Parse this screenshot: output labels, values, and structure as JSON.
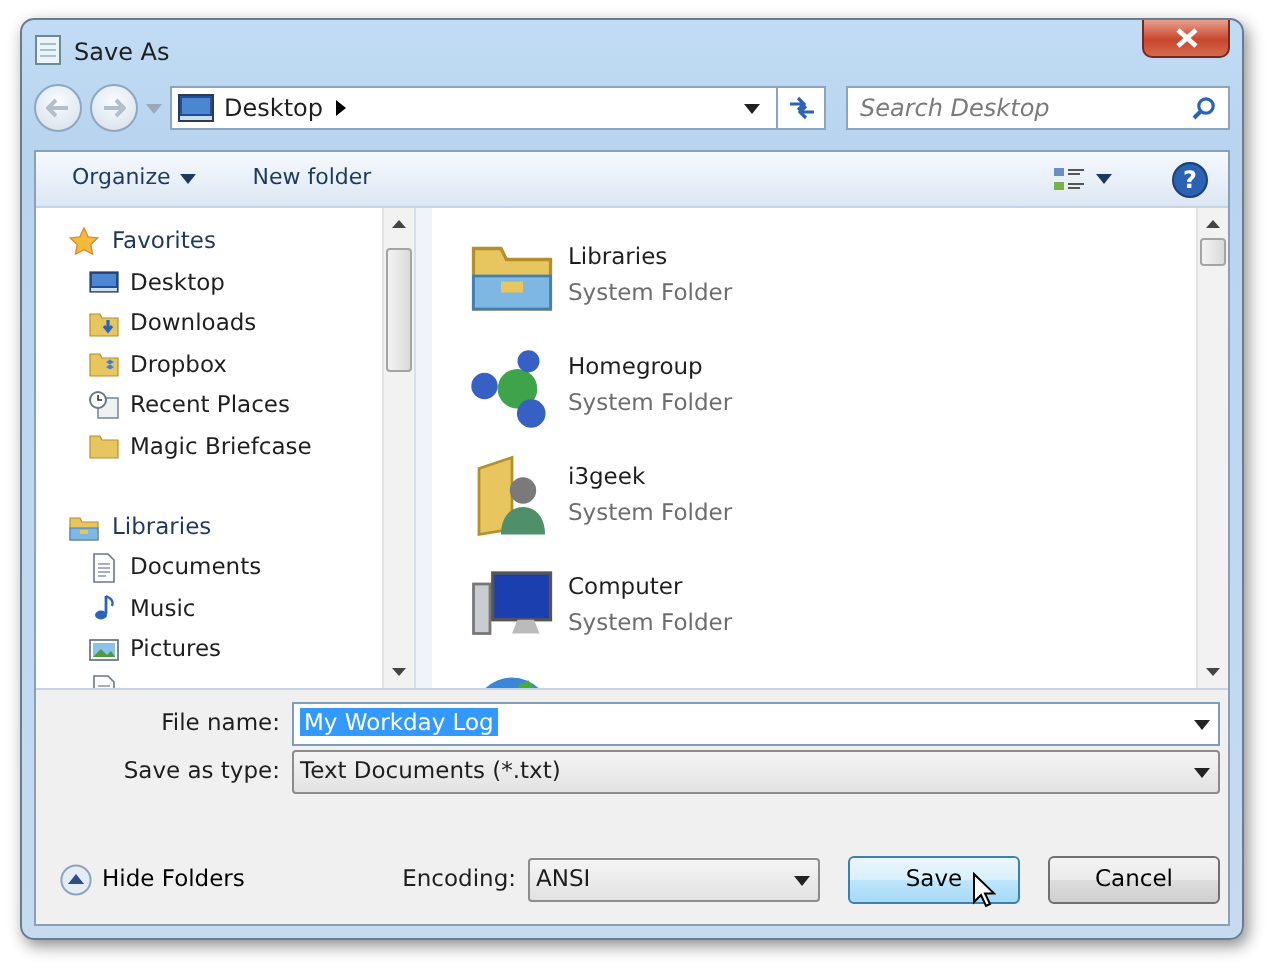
{
  "window": {
    "title": "Save As"
  },
  "navigation": {
    "address": "Desktop",
    "search_placeholder": "Search Desktop"
  },
  "toolbar": {
    "items": [
      "Organize",
      "New folder"
    ],
    "help": "?"
  },
  "sidebar": {
    "groups": [
      {
        "label": "Favorites",
        "kind": "star",
        "children": [
          {
            "label": "Desktop",
            "kind": "desktop"
          },
          {
            "label": "Downloads",
            "kind": "downloads"
          },
          {
            "label": "Dropbox",
            "kind": "dropbox"
          },
          {
            "label": "Recent Places",
            "kind": "recent"
          },
          {
            "label": "Magic Briefcase",
            "kind": "folder"
          }
        ]
      },
      {
        "label": "Libraries",
        "kind": "libraries",
        "children": [
          {
            "label": "Documents",
            "kind": "document"
          },
          {
            "label": "Music",
            "kind": "music"
          },
          {
            "label": "Pictures",
            "kind": "pictures"
          },
          {
            "kind": "document"
          }
        ]
      }
    ]
  },
  "files": [
    {
      "name": "Libraries",
      "type": "System Folder",
      "kind": "libraries"
    },
    {
      "name": "Homegroup",
      "type": "System Folder",
      "kind": "homegroup"
    },
    {
      "name": "i3geek",
      "type": "System Folder",
      "kind": "user-folder"
    },
    {
      "name": "Computer",
      "type": "System Folder",
      "kind": "computer"
    },
    {
      "kind": "globe"
    }
  ],
  "form": {
    "file_name_label": "File name:",
    "file_name": "My Workday Log",
    "file_name_highlighted": true,
    "type_label": "Save as type:",
    "type_value": "Text Documents (*.txt)"
  },
  "footer": {
    "hide_folders": "Hide Folders",
    "encoding_label": "Encoding:",
    "encoding": "ANSI",
    "buttons": [
      {
        "label": "Save",
        "default": true
      },
      {
        "label": "Cancel",
        "default": false
      }
    ]
  }
}
